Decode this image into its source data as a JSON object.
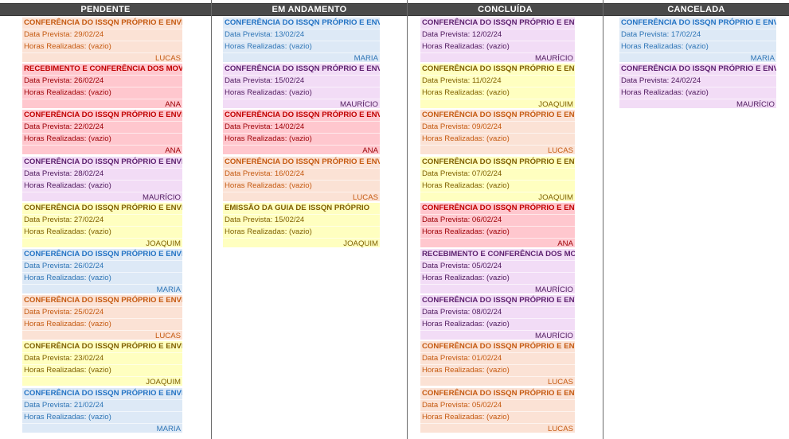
{
  "columns": [
    {
      "header": "PENDENTE",
      "cards": [
        {
          "title": "CONFERÊNCIA DO ISSQN PRÓPRIO E ENVIO DA",
          "date": "Data Prevista: 29/02/24",
          "hours": "Horas Realizadas: (vazio)",
          "owner": "LUCAS",
          "color": "orange"
        },
        {
          "title": "RECEBIMENTO E CONFERÊNCIA DOS MOVIMEN",
          "date": "Data Prevista: 26/02/24",
          "hours": "Horas Realizadas: (vazio)",
          "owner": "ANA",
          "color": "red"
        },
        {
          "title": "CONFERÊNCIA DO ISSQN PRÓPRIO E ENVIO DA",
          "date": "Data Prevista: 22/02/24",
          "hours": "Horas Realizadas: (vazio)",
          "owner": "ANA",
          "color": "red"
        },
        {
          "title": "CONFERÊNCIA DO ISSQN PRÓPRIO E ENVIO DA",
          "date": "Data Prevista: 28/02/24",
          "hours": "Horas Realizadas: (vazio)",
          "owner": "MAURÍCIO",
          "color": "purple"
        },
        {
          "title": "CONFERÊNCIA DO ISSQN PRÓPRIO E ENVIO DA",
          "date": "Data Prevista: 27/02/24",
          "hours": "Horas Realizadas: (vazio)",
          "owner": "JOAQUIM",
          "color": "yellow"
        },
        {
          "title": "CONFERÊNCIA DO ISSQN PRÓPRIO E ENVIO DA",
          "date": "Data Prevista: 26/02/24",
          "hours": "Horas Realizadas: (vazio)",
          "owner": "MARIA",
          "color": "blue"
        },
        {
          "title": "CONFERÊNCIA DO ISSQN PRÓPRIO E ENVIO DA",
          "date": "Data Prevista: 25/02/24",
          "hours": "Horas Realizadas: (vazio)",
          "owner": "LUCAS",
          "color": "orange"
        },
        {
          "title": "CONFERÊNCIA DO ISSQN PRÓPRIO E ENVIO DA",
          "date": "Data Prevista: 23/02/24",
          "hours": "Horas Realizadas: (vazio)",
          "owner": "JOAQUIM",
          "color": "yellow"
        },
        {
          "title": "CONFERÊNCIA DO ISSQN PRÓPRIO E ENVIO DA",
          "date": "Data Prevista: 21/02/24",
          "hours": "Horas Realizadas: (vazio)",
          "owner": "MARIA",
          "color": "blue"
        }
      ]
    },
    {
      "header": "EM ANDAMENTO",
      "cards": [
        {
          "title": "CONFERÊNCIA DO ISSQN PRÓPRIO E ENVIO DA",
          "date": "Data Prevista: 13/02/24",
          "hours": "Horas Realizadas: (vazio)",
          "owner": "MARIA",
          "color": "blue"
        },
        {
          "title": "CONFERÊNCIA DO ISSQN PRÓPRIO E ENVIO DA",
          "date": "Data Prevista: 15/02/24",
          "hours": "Horas Realizadas: (vazio)",
          "owner": "MAURÍCIO",
          "color": "purple"
        },
        {
          "title": "CONFERÊNCIA DO ISSQN PRÓPRIO E ENVIO DA",
          "date": "Data Prevista: 14/02/24",
          "hours": "Horas Realizadas: (vazio)",
          "owner": "ANA",
          "color": "red"
        },
        {
          "title": "CONFERÊNCIA DO ISSQN PRÓPRIO E ENVIO DA",
          "date": "Data Prevista: 16/02/24",
          "hours": "Horas Realizadas: (vazio)",
          "owner": "LUCAS",
          "color": "orange"
        },
        {
          "title": "EMISSÃO DA GUIA DE ISSQN PRÓPRIO",
          "date": "Data Prevista: 15/02/24",
          "hours": "Horas Realizadas: (vazio)",
          "owner": "JOAQUIM",
          "color": "yellow"
        }
      ]
    },
    {
      "header": "CONCLUÍDA",
      "cards": [
        {
          "title": "CONFERÊNCIA DO ISSQN PRÓPRIO E ENVIO DA",
          "date": "Data Prevista: 12/02/24",
          "hours": "Horas Realizadas: (vazio)",
          "owner": "MAURÍCIO",
          "color": "purple"
        },
        {
          "title": "CONFERÊNCIA DO ISSQN PRÓPRIO E ENVIO DA",
          "date": "Data Prevista: 11/02/24",
          "hours": "Horas Realizadas: (vazio)",
          "owner": "JOAQUIM",
          "color": "yellow"
        },
        {
          "title": "CONFERÊNCIA DO ISSQN PRÓPRIO E ENVIO DA",
          "date": "Data Prevista: 09/02/24",
          "hours": "Horas Realizadas: (vazio)",
          "owner": "LUCAS",
          "color": "orange"
        },
        {
          "title": "CONFERÊNCIA DO ISSQN PRÓPRIO E ENVIO DA",
          "date": "Data Prevista: 07/02/24",
          "hours": "Horas Realizadas: (vazio)",
          "owner": "JOAQUIM",
          "color": "yellow"
        },
        {
          "title": "CONFERÊNCIA DO ISSQN PRÓPRIO E ENVIO DA",
          "date": "Data Prevista: 06/02/24",
          "hours": "Horas Realizadas: (vazio)",
          "owner": "ANA",
          "color": "red"
        },
        {
          "title": "RECEBIMENTO E CONFERÊNCIA DOS MOVIMEN",
          "date": "Data Prevista: 05/02/24",
          "hours": "Horas Realizadas: (vazio)",
          "owner": "MAURÍCIO",
          "color": "purple"
        },
        {
          "title": "CONFERÊNCIA DO ISSQN PRÓPRIO E ENVIO DA",
          "date": "Data Prevista: 08/02/24",
          "hours": "Horas Realizadas: (vazio)",
          "owner": "MAURÍCIO",
          "color": "purple"
        },
        {
          "title": "CONFERÊNCIA DO ISSQN PRÓPRIO E ENVIO DA",
          "date": "Data Prevista: 01/02/24",
          "hours": "Horas Realizadas: (vazio)",
          "owner": "LUCAS",
          "color": "orange"
        },
        {
          "title": "CONFERÊNCIA DO ISSQN PRÓPRIO E ENVIO DA",
          "date": "Data Prevista: 05/02/24",
          "hours": "Horas Realizadas: (vazio)",
          "owner": "LUCAS",
          "color": "orange"
        }
      ]
    },
    {
      "header": "CANCELADA",
      "cards": [
        {
          "title": "CONFERÊNCIA DO ISSQN PRÓPRIO E ENVIO DA",
          "date": "Data Prevista: 17/02/24",
          "hours": "Horas Realizadas: (vazio)",
          "owner": "MARIA",
          "color": "blue"
        },
        {
          "title": "CONFERÊNCIA DO ISSQN PRÓPRIO E ENVIO DA",
          "date": "Data Prevista: 24/02/24",
          "hours": "Horas Realizadas: (vazio)",
          "owner": "MAURÍCIO",
          "color": "purple"
        }
      ]
    }
  ]
}
